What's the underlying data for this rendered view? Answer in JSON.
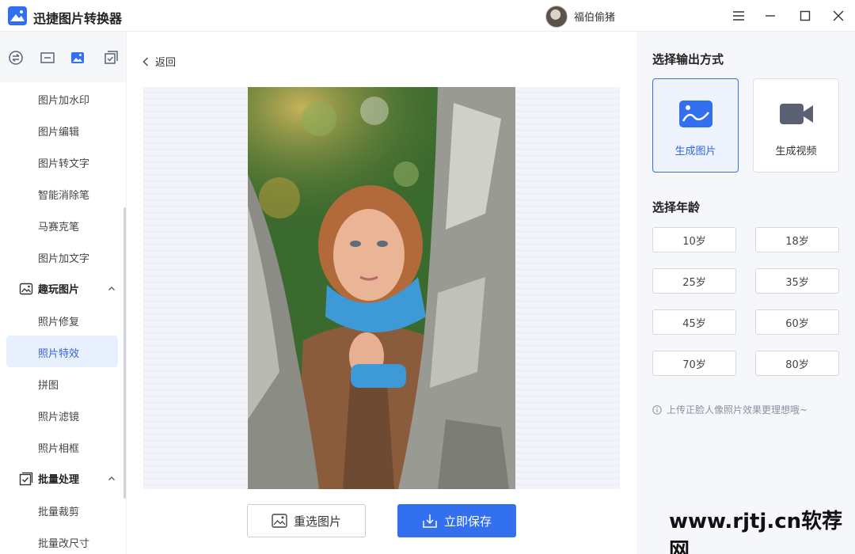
{
  "app": {
    "title": "迅捷图片转换器",
    "username": "福伯偷猪"
  },
  "sidebar": {
    "items_top": [
      {
        "label": "图片加水印"
      },
      {
        "label": "图片编辑"
      },
      {
        "label": "图片转文字"
      },
      {
        "label": "智能消除笔"
      },
      {
        "label": "马赛克笔"
      },
      {
        "label": "图片加文字"
      }
    ],
    "section_fun": {
      "label": "趣玩图片"
    },
    "items_fun": [
      {
        "label": "照片修复"
      },
      {
        "label": "照片特效"
      },
      {
        "label": "拼图"
      },
      {
        "label": "照片滤镜"
      },
      {
        "label": "照片相框"
      }
    ],
    "section_batch": {
      "label": "批量处理"
    },
    "items_batch": [
      {
        "label": "批量裁剪"
      },
      {
        "label": "批量改尺寸"
      }
    ],
    "active_item": "照片特效"
  },
  "main": {
    "back_label": "返回",
    "reselect_label": "重选图片",
    "save_label": "立即保存"
  },
  "panel": {
    "output_heading": "选择输出方式",
    "modes": [
      {
        "label": "生成图片",
        "selected": true
      },
      {
        "label": "生成视频",
        "selected": false
      }
    ],
    "age_heading": "选择年龄",
    "ages": [
      "10岁",
      "18岁",
      "25岁",
      "35岁",
      "45岁",
      "60岁",
      "70岁",
      "80岁"
    ],
    "hint": "上传正脸人像照片效果更理想哦~"
  },
  "watermark": "www.rjtj.cn软荐网",
  "colors": {
    "accent": "#3370f0",
    "active_bg": "#e8effd",
    "panel_bg": "#f6f7fb"
  }
}
